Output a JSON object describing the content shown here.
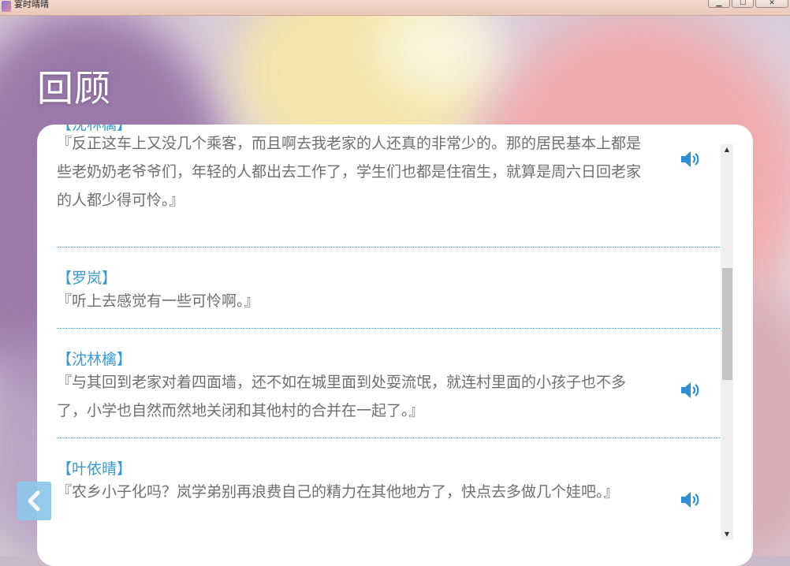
{
  "window": {
    "title": "宴时晴晴",
    "buttons": [
      "minimize",
      "maximize",
      "close"
    ]
  },
  "page": {
    "heading": "回顾"
  },
  "log": [
    {
      "speaker": "【沈林檎】",
      "text": "『反正这车上又没几个乘客，而且啊去我老家的人还真的非常少的。那的居民基本上都是些老奶奶老爷爷们，年轻的人都出去工作了，学生们也都是住宿生，就算是周六日回老家的人都少得可怜。』",
      "has_voice": true
    },
    {
      "speaker": "【罗岚】",
      "text": "『听上去感觉有一些可怜啊。』",
      "has_voice": false
    },
    {
      "speaker": "【沈林檎】",
      "text": "『与其回到老家对着四面墙，还不如在城里面到处耍流氓，就连村里面的小孩子也不多了，小学也自然而然地关闭和其他村的合并在一起了。』",
      "has_voice": true
    },
    {
      "speaker": "【叶依晴】",
      "text": "『农乡小子化吗？岚学弟别再浪费自己的精力在其他地方了，快点去多做几个娃吧。』",
      "has_voice": true
    }
  ],
  "icons": {
    "voice": "speaker-icon",
    "back": "back-arrow-icon"
  },
  "colors": {
    "speaker_name": "#3a9bd0",
    "dialogue": "#6f6f6f",
    "divider": "#5a97b8",
    "voice_icon": "#2f8fd0",
    "back_button": "#8ec7ea"
  }
}
